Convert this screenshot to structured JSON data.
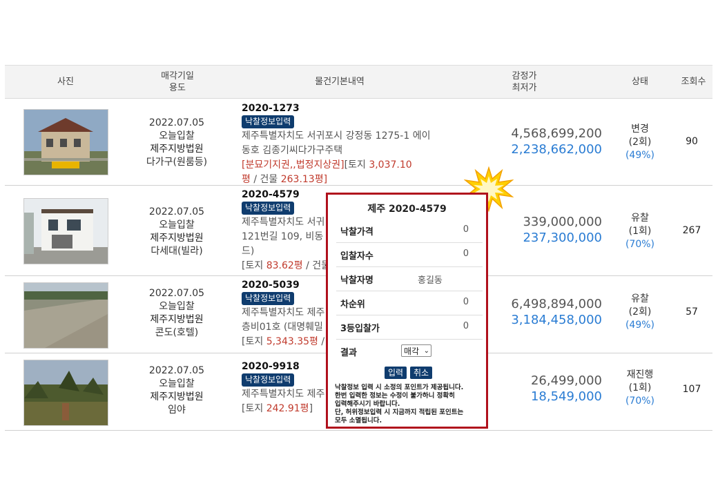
{
  "headers": {
    "photo": "사진",
    "date_line1": "매각기일",
    "date_line2": "용도",
    "info": "물건기본내역",
    "price_line1": "감정가",
    "price_line2": "최저가",
    "status": "상태",
    "views": "조회수"
  },
  "rows": [
    {
      "date": "2022.07.05",
      "bid_type": "오늘입찰",
      "court": "제주지방법원",
      "usage": "다가구(원룸등)",
      "case_no": "2020-1273",
      "bid_btn": "낙찰정보입력",
      "address_l1": "제주특별자치도 서귀포시 강정동 1275-1 에이",
      "address_l2": "동호 김종기씨다가구주택",
      "tags": "[분묘기지권,,법정지상권]",
      "land_prefix": "[토지 ",
      "land_area": "3,037.10",
      "land_area_unit": "평",
      "bldg_prefix": " / 건물 ",
      "bldg_area": "263.13평]",
      "appraisal": "4,568,699,200",
      "minimum": "2,238,662,000",
      "status": "변경",
      "rounds": "(2회)",
      "pct": "(49%)",
      "views": "90"
    },
    {
      "date": "2022.07.05",
      "bid_type": "오늘입찰",
      "court": "제주지방법원",
      "usage": "다세대(빌라)",
      "case_no": "2020-4579",
      "bid_btn": "낙찰정보입력",
      "address_l1": "제주특별자치도 서귀",
      "address_l2": "121번길 109, 비동 1",
      "address_l3": "드)",
      "land_prefix": "[토지 ",
      "land_area": "83.62평",
      "bldg_prefix": " / 건물",
      "appraisal": "339,000,000",
      "minimum": "237,300,000",
      "status": "유찰",
      "rounds": "(1회)",
      "pct": "(70%)",
      "views": "267"
    },
    {
      "date": "2022.07.05",
      "bid_type": "오늘입찰",
      "court": "제주지방법원",
      "usage": "콘도(호텔)",
      "case_no": "2020-5039",
      "bid_btn": "낙찰정보입력",
      "address_l1": "제주특별자치도 제주",
      "address_l2": "층비01호 (대명훼밀",
      "land_prefix": "[토지 ",
      "land_area": "5,343.35평",
      "bldg_prefix": " /",
      "appraisal": "6,498,894,000",
      "minimum": "3,184,458,000",
      "status": "유찰",
      "rounds": "(2회)",
      "pct": "(49%)",
      "views": "57"
    },
    {
      "date": "2022.07.05",
      "bid_type": "오늘입찰",
      "court": "제주지방법원",
      "usage": "임야",
      "case_no": "2020-9918",
      "bid_btn": "낙찰정보입력",
      "address_l1": "제주특별자치도 제주",
      "land_prefix": "[토지 ",
      "land_area": "242.91평",
      "land_suffix": "]",
      "appraisal": "26,499,000",
      "minimum": "18,549,000",
      "status": "재진행",
      "rounds": "(1회)",
      "pct": "(70%)",
      "views": "107"
    }
  ],
  "popup": {
    "title": "제주 2020-4579",
    "fields": [
      {
        "label": "낙찰가격",
        "value": "0"
      },
      {
        "label": "입찰자수",
        "value": "0"
      },
      {
        "label": "낙찰자명",
        "value": "홍길동"
      },
      {
        "label": "차순위",
        "value": "0"
      },
      {
        "label": "3등입찰가",
        "value": "0"
      }
    ],
    "result_label": "결과",
    "result_value": "매각",
    "submit_label": "입력",
    "cancel_label": "취소",
    "notice_1": "낙찰정보 입력 시 소정의 포인트가 제공됩니다.",
    "notice_2": "한번 입력한 정보는 수정이 불가하니 정확히",
    "notice_3": "입력해주시기 바랍니다.",
    "notice_4": "단, 허위정보입력 시 지금까지 적립된 포인트는",
    "notice_5": "모두 소멸됩니다."
  },
  "colors": {
    "navy": "#0f3c6e",
    "accent_blue": "#2a7cd3",
    "red": "#c0392b",
    "popup_border": "#b0101c",
    "burst": "#ffd000"
  }
}
